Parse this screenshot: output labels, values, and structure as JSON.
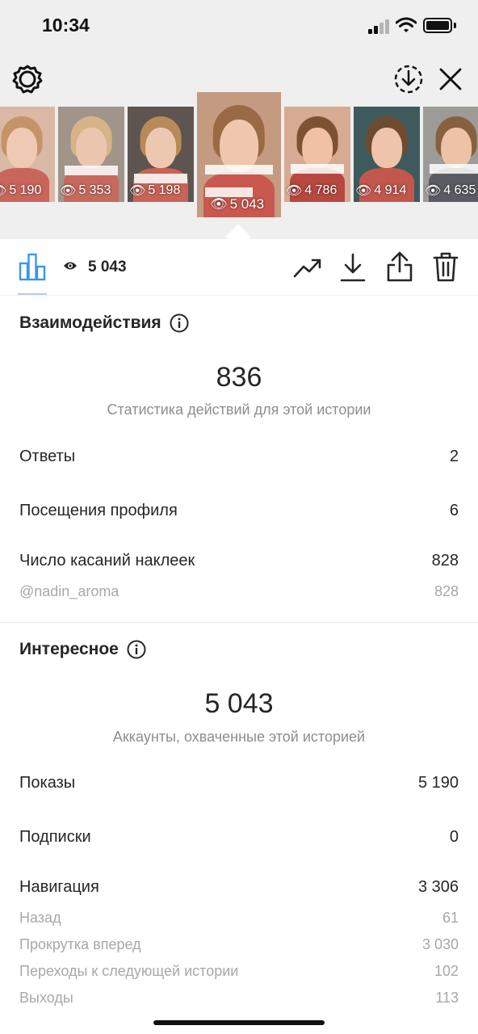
{
  "status_bar": {
    "time": "10:34"
  },
  "thumbnails": [
    {
      "views": "5 190",
      "palette": {
        "bg": "#d9b8a6",
        "hair": "#c49468",
        "face": "#efc9b3",
        "body": "#c9665c"
      }
    },
    {
      "views": "5 353",
      "palette": {
        "bg": "#a1948b",
        "hair": "#d6b487",
        "face": "#ecc6ae",
        "body": "#c76a5e"
      }
    },
    {
      "views": "5 198",
      "palette": {
        "bg": "#5e5450",
        "hair": "#b98a59",
        "face": "#edc8b1",
        "body": "#c96357"
      }
    },
    {
      "views": "5 043",
      "palette": {
        "bg": "#c49a80",
        "hair": "#9a6a44",
        "face": "#f0c7ad",
        "body": "#c9584e"
      }
    },
    {
      "views": "4 786",
      "palette": {
        "bg": "#d6aa93",
        "hair": "#7c5232",
        "face": "#f1c1a3",
        "body": "#b6483f"
      }
    },
    {
      "views": "4 914",
      "palette": {
        "bg": "#3f5a5c",
        "hair": "#6e4a31",
        "face": "#eec4ab",
        "body": "#c2574e"
      }
    },
    {
      "views": "4 635",
      "palette": {
        "bg": "#9d9b98",
        "hair": "#86613f",
        "face": "#eec2a6",
        "body": "#5b5b63"
      }
    }
  ],
  "toolbar": {
    "views_total": "5 043"
  },
  "interactions": {
    "title": "Взаимодействия",
    "total": "836",
    "caption": "Статистика действий для этой истории",
    "rows": [
      {
        "label": "Ответы",
        "value": "2"
      },
      {
        "label": "Посещения профиля",
        "value": "6"
      },
      {
        "label": "Число касаний наклеек",
        "value": "828"
      }
    ],
    "sticker_detail": {
      "label": "@nadin_aroma",
      "value": "828"
    }
  },
  "discovery": {
    "title": "Интересное",
    "total": "5 043",
    "caption": "Аккаунты, охваченные этой историей",
    "rows": [
      {
        "label": "Показы",
        "value": "5 190"
      },
      {
        "label": "Подписки",
        "value": "0"
      },
      {
        "label": "Навигация",
        "value": "3 306"
      }
    ],
    "navigation_details": [
      {
        "label": "Назад",
        "value": "61"
      },
      {
        "label": "Прокрутка вперед",
        "value": "3 030"
      },
      {
        "label": "Переходы к следующей истории",
        "value": "102"
      },
      {
        "label": "Выходы",
        "value": "113"
      }
    ]
  }
}
